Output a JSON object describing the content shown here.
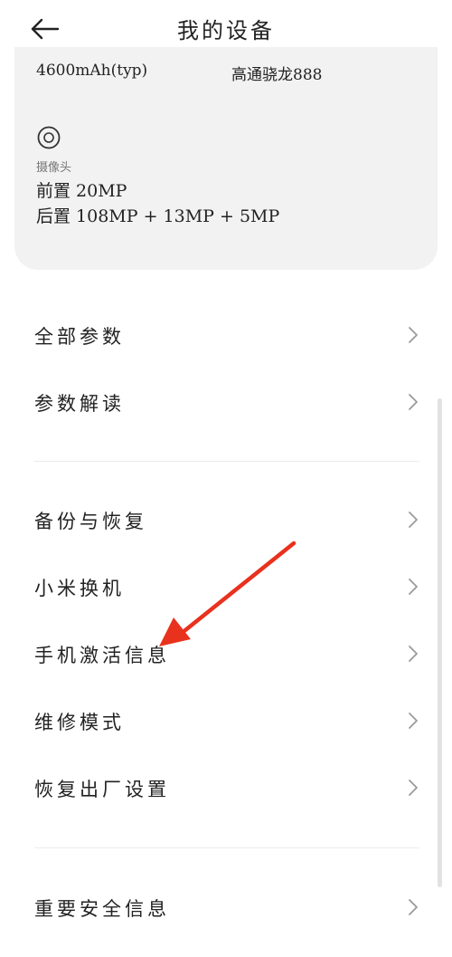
{
  "header": {
    "title": "我的设备",
    "back_icon": "arrow-left-icon"
  },
  "spec_card": {
    "battery": "4600mAh(typ)",
    "processor": "高通骁龙888",
    "camera_icon": "camera-lens-icon",
    "camera_label": "摄像头",
    "front_camera": "前置 20MP",
    "rear_camera": "后置 108MP + 13MP + 5MP"
  },
  "list": {
    "group1": [
      "全部参数",
      "参数解读"
    ],
    "group2": [
      "备份与恢复",
      "小米换机",
      "手机激活信息",
      "维修模式",
      "恢复出厂设置"
    ],
    "group3": [
      "重要安全信息"
    ]
  },
  "annotation": {
    "arrow_color": "#e8321e",
    "points_to": "手机激活信息"
  },
  "colors": {
    "card_bg": "#f2f2f2",
    "text": "#222222",
    "chevron": "#9a9a9a"
  }
}
